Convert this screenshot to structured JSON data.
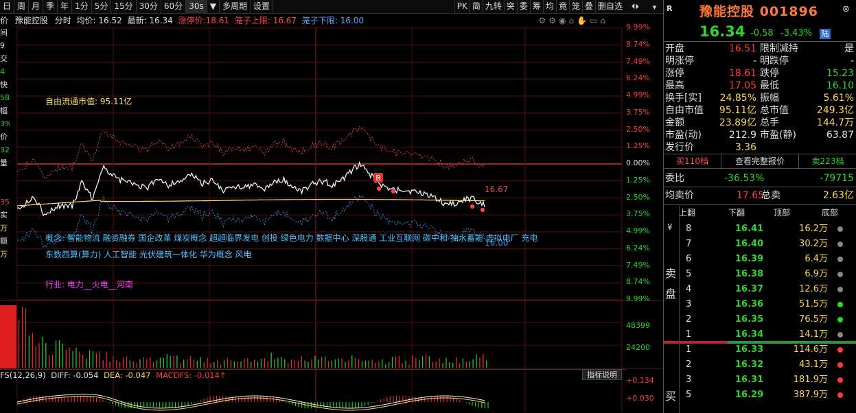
{
  "toolbar": {
    "periods": [
      "日",
      "周",
      "月",
      "季",
      "年",
      "1分",
      "5分",
      "15分",
      "30分",
      "60分",
      "30s",
      "▼",
      "多周期",
      "设置"
    ],
    "right_tools": [
      "PK",
      "简",
      "九转",
      "突",
      "委",
      "筹",
      "均",
      "竟",
      "笼",
      "叠",
      "删自选"
    ],
    "arrows": [
      "⏴⏵",
      "▾"
    ]
  },
  "infobar": {
    "prefix": "价",
    "stock": "豫能控股",
    "view": "分时",
    "avg": "均价: 16.52",
    "latest": "最新: 16.34",
    "limit_up": "涨停价:18.61",
    "cage_upper": "笼子上限: 16.67",
    "cage_lower": "笼子下限: 16.00"
  },
  "left_strip": [
    "间",
    "9",
    "交",
    "4",
    "快",
    "58",
    "幅",
    "3%",
    "价",
    "32",
    "量",
    "",
    "",
    "35",
    "实",
    "万",
    "额",
    "万"
  ],
  "chart": {
    "right_axis_pct": [
      "9.99%",
      "8.74%",
      "7.49%",
      "6.24%",
      "4.99%",
      "3.75%",
      "2.50%",
      "1.25%",
      "0.00%",
      "1.25%",
      "2.50%",
      "3.75%",
      "4.99%",
      "6.24%",
      "7.49%",
      "8.74%",
      "9.99%"
    ],
    "volume_axis": [
      "48399",
      "24200"
    ],
    "macd_axis": [
      "+0.134",
      "+0.030"
    ],
    "free_cap_label": "自由流通市值: 95.11亿",
    "concept_line1": "概念: 智能物流  融资融券  国企改革  煤炭概念  超超临界发电  创投  绿色电力  数据中心  深股通  工业互联网  碳中和  抽水蓄能  虚拟电厂  充电",
    "concept_line2": "东数西算(算力)  人工智能  光伏建筑一体化  华为概念  风电",
    "industry": "行业: 电力__火电__河南",
    "cage_upper_marker": "16.67",
    "cage_lower_marker": "16.00",
    "buy_marker": "B",
    "macd_title": "FS(12,26,9)",
    "macd_diff": "DIFF: -0.054",
    "macd_dea": "DEA: -0.047",
    "macd_macd": "MACDFS: -0.014↑",
    "indicator_button": "指标说明"
  },
  "panel": {
    "badge": "R",
    "name": "豫能控股 001896",
    "price": "16.34",
    "change": "-0.58",
    "change_pct": "-3.43%",
    "exchange_tag": "陆",
    "stats": [
      {
        "l1": "开盘",
        "v1": "16.51",
        "c1": "red",
        "l2": "限制减持",
        "v2": "是",
        "c2": "wht"
      },
      {
        "l1": "明涨停",
        "v1": "-",
        "c1": "wht",
        "l2": "明跌停",
        "v2": "-",
        "c2": "wht"
      },
      {
        "l1": "涨停",
        "v1": "18.61",
        "c1": "red",
        "l2": "跌停",
        "v2": "15.23",
        "c2": "grn"
      },
      {
        "l1": "最高",
        "v1": "17.05",
        "c1": "red",
        "l2": "最低",
        "v2": "16.10",
        "c2": "grn"
      },
      {
        "l1": "换手[实]",
        "v1": "24.85%",
        "c1": "yel",
        "l2": "振幅",
        "v2": "5.61%",
        "c2": "yel"
      },
      {
        "l1": "自由市值",
        "v1": "95.11亿",
        "c1": "yel",
        "l2": "总市值",
        "v2": "249.3亿",
        "c2": "yel"
      },
      {
        "l1": "金额",
        "v1": "23.89亿",
        "c1": "yel",
        "l2": "总手",
        "v2": "144.7万",
        "c2": "yel"
      },
      {
        "l1": "市盈(动)",
        "v1": "212.9",
        "c1": "wht",
        "l2": "市盈(静)",
        "v2": "63.87",
        "c2": "wht"
      },
      {
        "l1": "发行价",
        "v1": "3.36",
        "c1": "yel",
        "l2": "",
        "v2": "",
        "c2": "wht"
      }
    ],
    "tabs": {
      "buy": "买110档",
      "full": "查看完整报价",
      "sell": "卖223档"
    },
    "ratio": {
      "label": "委比",
      "pct": "-36.53%",
      "diff": "-79715"
    },
    "avg_sell": {
      "label": "均卖价",
      "price": "17.65",
      "total_label": "总卖",
      "total": "2.63亿"
    },
    "book_header": [
      "上翻",
      "下翻",
      "顶部",
      "底部"
    ],
    "sell_label": [
      "卖",
      "盘"
    ],
    "buy_label": [
      "买"
    ],
    "sells": [
      {
        "n": "8",
        "p": "16.41",
        "v": "16.2万",
        "dot": "#888"
      },
      {
        "n": "7",
        "p": "16.40",
        "v": "30.2万",
        "dot": "#888"
      },
      {
        "n": "6",
        "p": "16.39",
        "v": "6.4万",
        "dot": "#888"
      },
      {
        "n": "5",
        "p": "16.38",
        "v": "6.9万",
        "dot": "#888"
      },
      {
        "n": "4",
        "p": "16.37",
        "v": "12.6万",
        "dot": "#888"
      },
      {
        "n": "3",
        "p": "16.36",
        "v": "51.5万",
        "dot": "#22dd22"
      },
      {
        "n": "2",
        "p": "16.35",
        "v": "76.5万",
        "dot": "#22dd22"
      },
      {
        "n": "1",
        "p": "16.34",
        "v": "14.1万",
        "dot": "#888"
      }
    ],
    "buys": [
      {
        "n": "1",
        "p": "16.33",
        "v": "114.6万",
        "dot": "#ff3c3c"
      },
      {
        "n": "2",
        "p": "16.32",
        "v": "43.1万",
        "dot": "#ff3c3c"
      },
      {
        "n": "3",
        "p": "16.31",
        "v": "181.9万",
        "dot": "#ff3c3c"
      },
      {
        "n": "5",
        "p": "16.29",
        "v": "387.9万",
        "dot": "#ff3c3c"
      }
    ],
    "colors": {
      "up": "#ff3c3c",
      "down": "#2cd62c",
      "accent": "#ffd84a",
      "cyan": "#4ec0ff"
    }
  }
}
